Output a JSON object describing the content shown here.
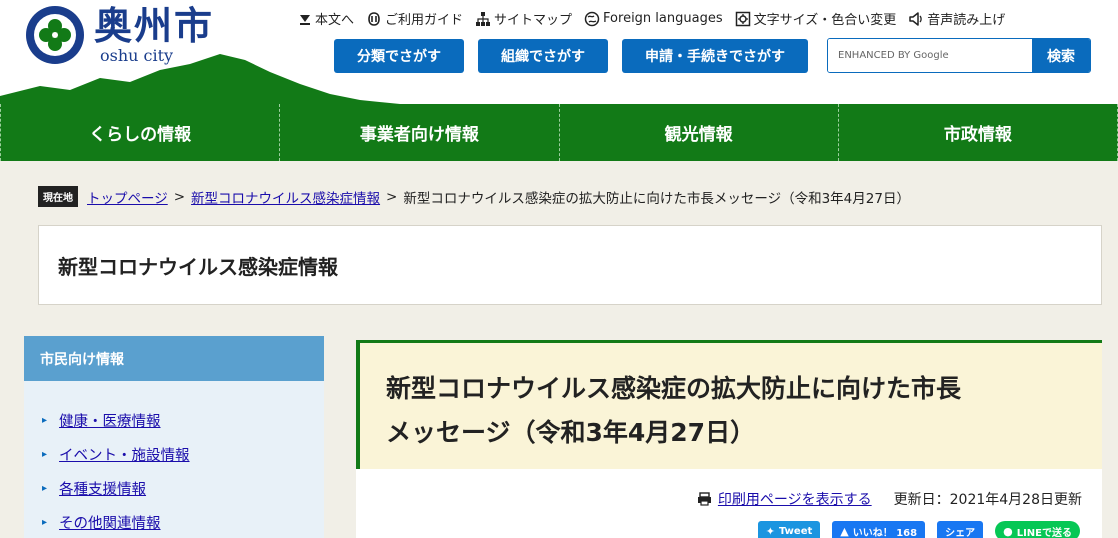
{
  "header": {
    "logo_kanji": "奥州市",
    "logo_roman": "oshu city",
    "utility_links": [
      {
        "label": "本文へ",
        "icon": "arrow-down-to-line-icon"
      },
      {
        "label": "ご利用ガイド",
        "icon": "guide-icon"
      },
      {
        "label": "サイトマップ",
        "icon": "sitemap-icon"
      },
      {
        "label": "Foreign languages",
        "icon": "globe-icon"
      },
      {
        "label": "文字サイズ・色合い変更",
        "icon": "settings-icon"
      },
      {
        "label": "音声読み上げ",
        "icon": "speaker-icon"
      }
    ],
    "search_buttons": [
      "分類でさがす",
      "組織でさがす",
      "申請・手続きでさがす"
    ],
    "search": {
      "placeholder": "ENHANCED BY Google",
      "submit_label": "検索"
    }
  },
  "global_nav": [
    "くらしの情報",
    "事業者向け情報",
    "観光情報",
    "市政情報"
  ],
  "breadcrumb": {
    "here_label": "現在地",
    "links": [
      "トップページ",
      "新型コロナウイルス感染症情報"
    ],
    "separator": ">",
    "current": "新型コロナウイルス感染症の拡大防止に向けた市長メッセージ（令和3年4月27日）"
  },
  "category": {
    "title": "新型コロナウイルス感染症情報"
  },
  "sidebar": {
    "heading": "市民向け情報",
    "items": [
      "健康・医療情報",
      "イベント・施設情報",
      "各種支援情報",
      "その他関連情報"
    ]
  },
  "article": {
    "title_line1": "新型コロナウイルス感染症の拡大防止に向けた市長",
    "title_line2": "メッセージ（令和3年4月27日）",
    "print_label": "印刷用ページを表示する",
    "updated": "更新日：2021年4月28日更新"
  },
  "share": {
    "tweet": "Tweet",
    "like": "いいね！ 168",
    "share": "シェア",
    "line": "LINEで送る"
  },
  "colors": {
    "nav_green": "#127a17",
    "button_blue": "#0a6bbd",
    "logo_blue": "#1a3d8c",
    "title_bg": "#faf4d7",
    "sidebar_head": "#5aa0cf"
  }
}
